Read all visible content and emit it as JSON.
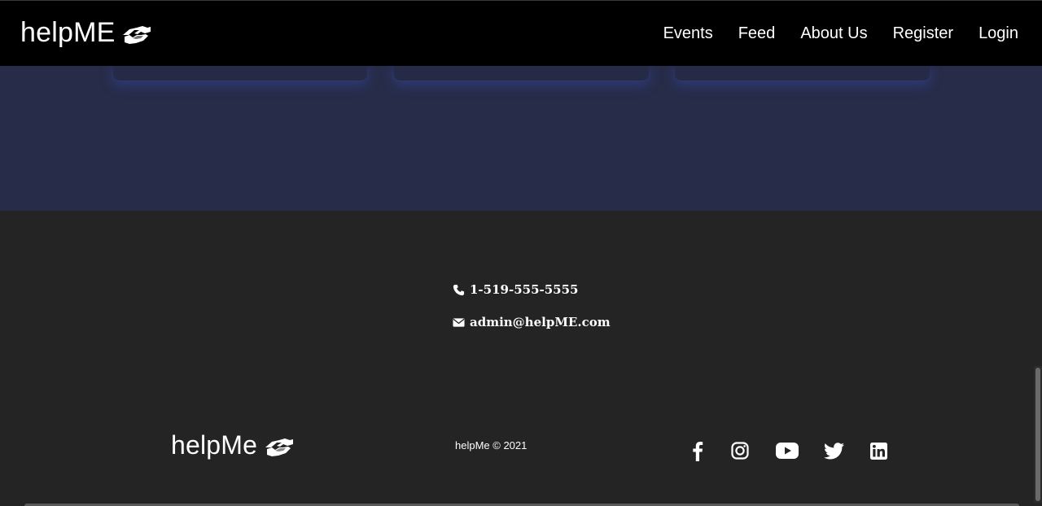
{
  "header": {
    "brand": "helpME",
    "brand_icon": "handshake-icon",
    "nav": [
      {
        "label": "Events"
      },
      {
        "label": "Feed"
      },
      {
        "label": "About Us"
      },
      {
        "label": "Register"
      },
      {
        "label": "Login"
      }
    ]
  },
  "footer": {
    "phone": "1-519-555-5555",
    "phone_icon": "phone-icon",
    "email": "admin@helpME.com",
    "email_icon": "envelope-icon",
    "brand": "helpMe",
    "copyright": "helpMe © 2021",
    "social": [
      "facebook-icon",
      "instagram-icon",
      "youtube-icon",
      "twitter-icon",
      "linkedin-icon"
    ]
  },
  "colors": {
    "navbar": "#000000",
    "content_band": "#272c48",
    "footer": "#242424",
    "text": "#ffffff"
  }
}
